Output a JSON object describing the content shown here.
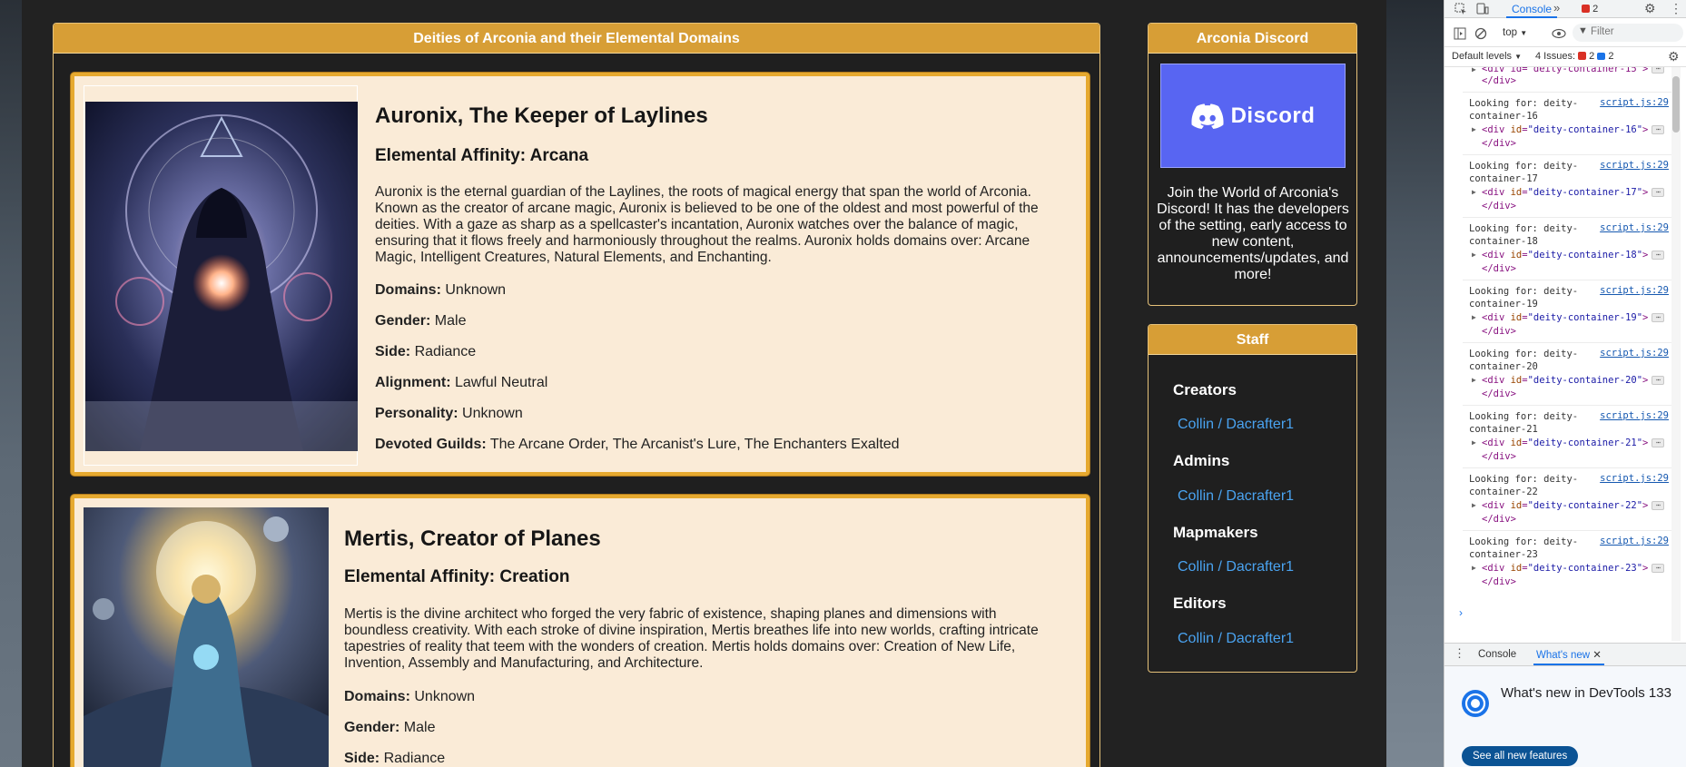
{
  "main_header": "Deities of Arconia and their Elemental Domains",
  "deities": [
    {
      "name": "Auronix, The Keeper of Laylines",
      "affinity": "Elemental Affinity: Arcana",
      "description_lines": [
        "Auronix is the eternal guardian of the Laylines, the roots of magical energy that span the world of Arconia.",
        "Known as the creator of arcane magic, Auronix is believed to be one of the oldest and most powerful of the",
        "deities. With a gaze as sharp as a spellcaster's incantation, Auronix watches over the balance of magic,",
        "ensuring that it flows freely and harmoniously throughout the realms. Auronix holds domains over: Arcane",
        "Magic, Intelligent Creatures, Natural Elements, and Enchanting."
      ],
      "attributes": [
        {
          "label": "Domains:",
          "value": "Unknown"
        },
        {
          "label": "Gender:",
          "value": "Male"
        },
        {
          "label": "Side:",
          "value": "Radiance"
        },
        {
          "label": "Alignment:",
          "value": "Lawful Neutral"
        },
        {
          "label": "Personality:",
          "value": "Unknown"
        },
        {
          "label": "Devoted Guilds:",
          "value": "The Arcane Order, The Arcanist's Lure, The Enchanters Exalted"
        }
      ]
    },
    {
      "name": "Mertis, Creator of Planes",
      "affinity": "Elemental Affinity: Creation",
      "description_lines": [
        "Mertis is the divine architect who forged the very fabric of existence, shaping planes and dimensions with",
        "boundless creativity. With each stroke of divine inspiration, Mertis breathes life into new worlds, crafting intricate",
        "tapestries of reality that teem with the wonders of creation. Mertis holds domains over: Creation of New Life,",
        "Invention, Assembly and Manufacturing, and Architecture."
      ],
      "attributes": [
        {
          "label": "Domains:",
          "value": "Unknown"
        },
        {
          "label": "Gender:",
          "value": "Male"
        },
        {
          "label": "Side:",
          "value": "Radiance"
        }
      ]
    }
  ],
  "discord": {
    "header": "Arconia Discord",
    "banner_word": "Discord",
    "text": "Join the World of Arconia's Discord! It has the developers of the setting, early access to new content, announcements/updates, and more!"
  },
  "staff": {
    "header": "Staff",
    "groups": [
      {
        "role": "Creators",
        "member": "Collin / Dacrafter1"
      },
      {
        "role": "Admins",
        "member": "Collin / Dacrafter1"
      },
      {
        "role": "Mapmakers",
        "member": "Collin / Dacrafter1"
      },
      {
        "role": "Editors",
        "member": "Collin / Dacrafter1"
      }
    ]
  },
  "devtools": {
    "console_tab": "Console",
    "error_count": "2",
    "context": "top",
    "filter_placeholder": "Filter",
    "levels": "Default levels",
    "issues_label": "4 Issues:",
    "issues_errors": "2",
    "issues_info": "2",
    "log_top": {
      "elem": "<div id=\"deity-container-15\">",
      "close": "</div>"
    },
    "log_entries": [
      {
        "text1": "Looking for: deity-",
        "text2": "container-16",
        "link": "script.js:29",
        "id": "deity-container-16"
      },
      {
        "text1": "Looking for: deity-",
        "text2": "container-17",
        "link": "script.js:29",
        "id": "deity-container-17"
      },
      {
        "text1": "Looking for: deity-",
        "text2": "container-18",
        "link": "script.js:29",
        "id": "deity-container-18"
      },
      {
        "text1": "Looking for: deity-",
        "text2": "container-19",
        "link": "script.js:29",
        "id": "deity-container-19"
      },
      {
        "text1": "Looking for: deity-",
        "text2": "container-20",
        "link": "script.js:29",
        "id": "deity-container-20"
      },
      {
        "text1": "Looking for: deity-",
        "text2": "container-21",
        "link": "script.js:29",
        "id": "deity-container-21"
      },
      {
        "text1": "Looking for: deity-",
        "text2": "container-22",
        "link": "script.js:29",
        "id": "deity-container-22"
      },
      {
        "text1": "Looking for: deity-",
        "text2": "container-23",
        "link": "script.js:29",
        "id": "deity-container-23"
      }
    ],
    "drawer_tabs": [
      "Console",
      "What's new"
    ],
    "whatsnew_title": "What's new in DevTools 133",
    "see_all": "See all new features"
  }
}
